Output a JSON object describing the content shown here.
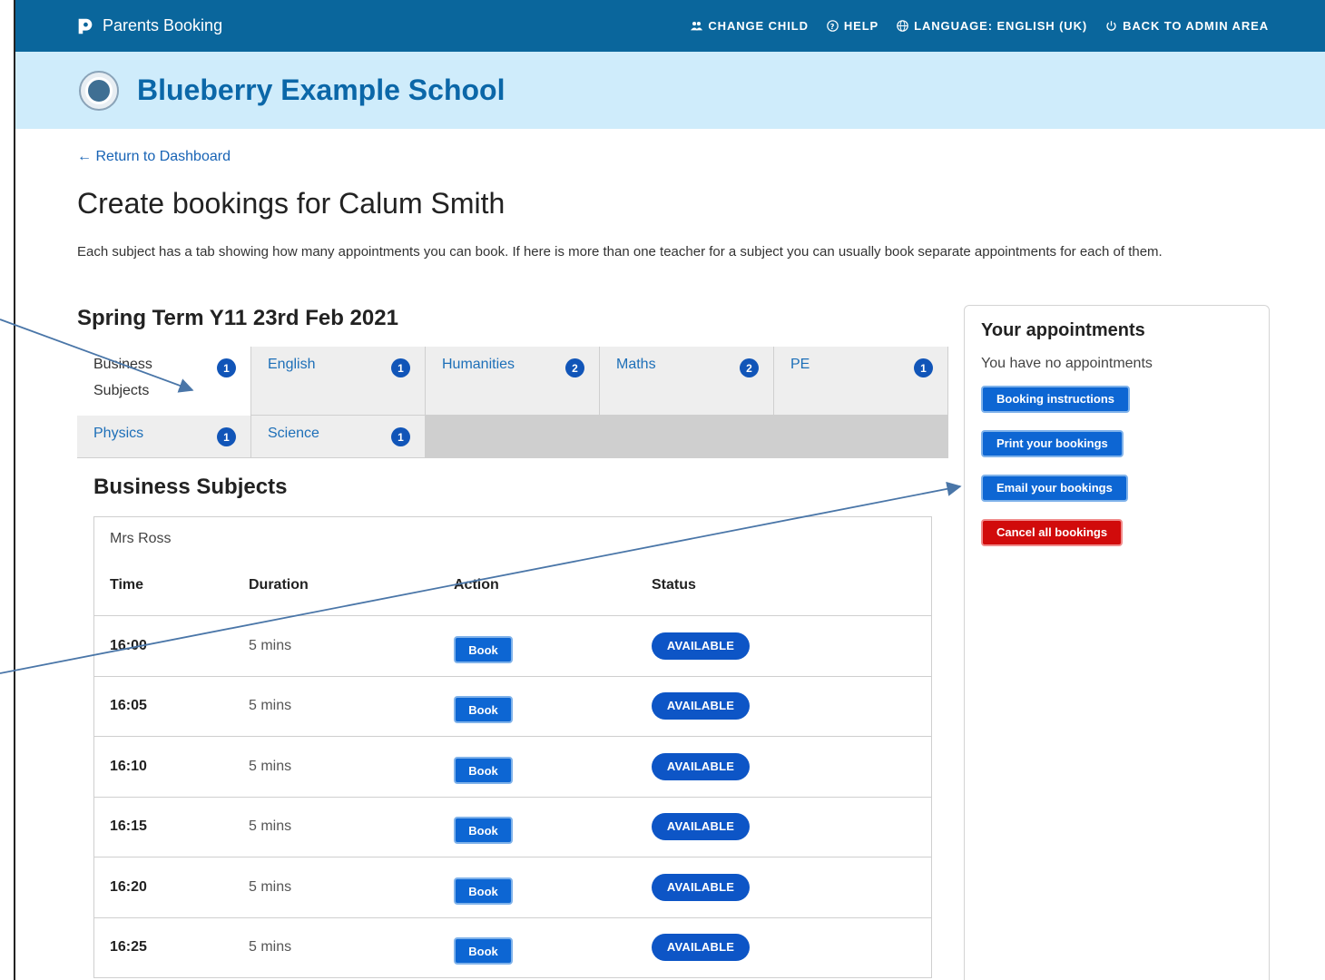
{
  "topbar": {
    "brand": "Parents Booking",
    "nav": [
      {
        "icon": "people-icon",
        "label": "CHANGE CHILD"
      },
      {
        "icon": "help-circle-icon",
        "label": "HELP"
      },
      {
        "icon": "globe-icon",
        "label": "LANGUAGE: ENGLISH (UK)"
      },
      {
        "icon": "power-icon",
        "label": "BACK TO ADMIN AREA"
      }
    ]
  },
  "banner": {
    "school_name": "Blueberry Example School"
  },
  "main": {
    "return_link": "← Return to Dashboard",
    "page_title": "Create bookings for Calum Smith",
    "intro": "Each subject has a tab showing how many appointments you can book. If here is more than one teacher for a subject you can usually book separate appointments for each of them.",
    "term_title": "Spring Term Y11 23rd Feb 2021",
    "tabs": [
      {
        "label": "Business Subjects",
        "count": "1",
        "active": true
      },
      {
        "label": "English",
        "count": "1"
      },
      {
        "label": "Humanities",
        "count": "2"
      },
      {
        "label": "Maths",
        "count": "2"
      },
      {
        "label": "PE",
        "count": "1"
      },
      {
        "label": "Physics",
        "count": "1"
      },
      {
        "label": "Science",
        "count": "1"
      }
    ],
    "section_title": "Business Subjects",
    "teacher": "Mrs Ross",
    "columns": {
      "time": "Time",
      "duration": "Duration",
      "action": "Action",
      "status": "Status"
    },
    "slots": [
      {
        "time": "16:00",
        "duration": "5 mins",
        "action": "Book",
        "status": "AVAILABLE"
      },
      {
        "time": "16:05",
        "duration": "5 mins",
        "action": "Book",
        "status": "AVAILABLE"
      },
      {
        "time": "16:10",
        "duration": "5 mins",
        "action": "Book",
        "status": "AVAILABLE"
      },
      {
        "time": "16:15",
        "duration": "5 mins",
        "action": "Book",
        "status": "AVAILABLE"
      },
      {
        "time": "16:20",
        "duration": "5 mins",
        "action": "Book",
        "status": "AVAILABLE"
      },
      {
        "time": "16:25",
        "duration": "5 mins",
        "action": "Book",
        "status": "AVAILABLE"
      }
    ]
  },
  "sidebar": {
    "title": "Your appointments",
    "empty_text": "You have no appointments",
    "buttons": {
      "instructions": "Booking instructions",
      "print": "Print your bookings",
      "email": "Email your bookings",
      "cancel": "Cancel all bookings"
    }
  },
  "colors": {
    "topbar": "#0a669c",
    "banner": "#cfecfb",
    "primary_button": "#0d66d3",
    "danger_button": "#d10b0b",
    "annotation_arrow": "#4a76a8"
  }
}
